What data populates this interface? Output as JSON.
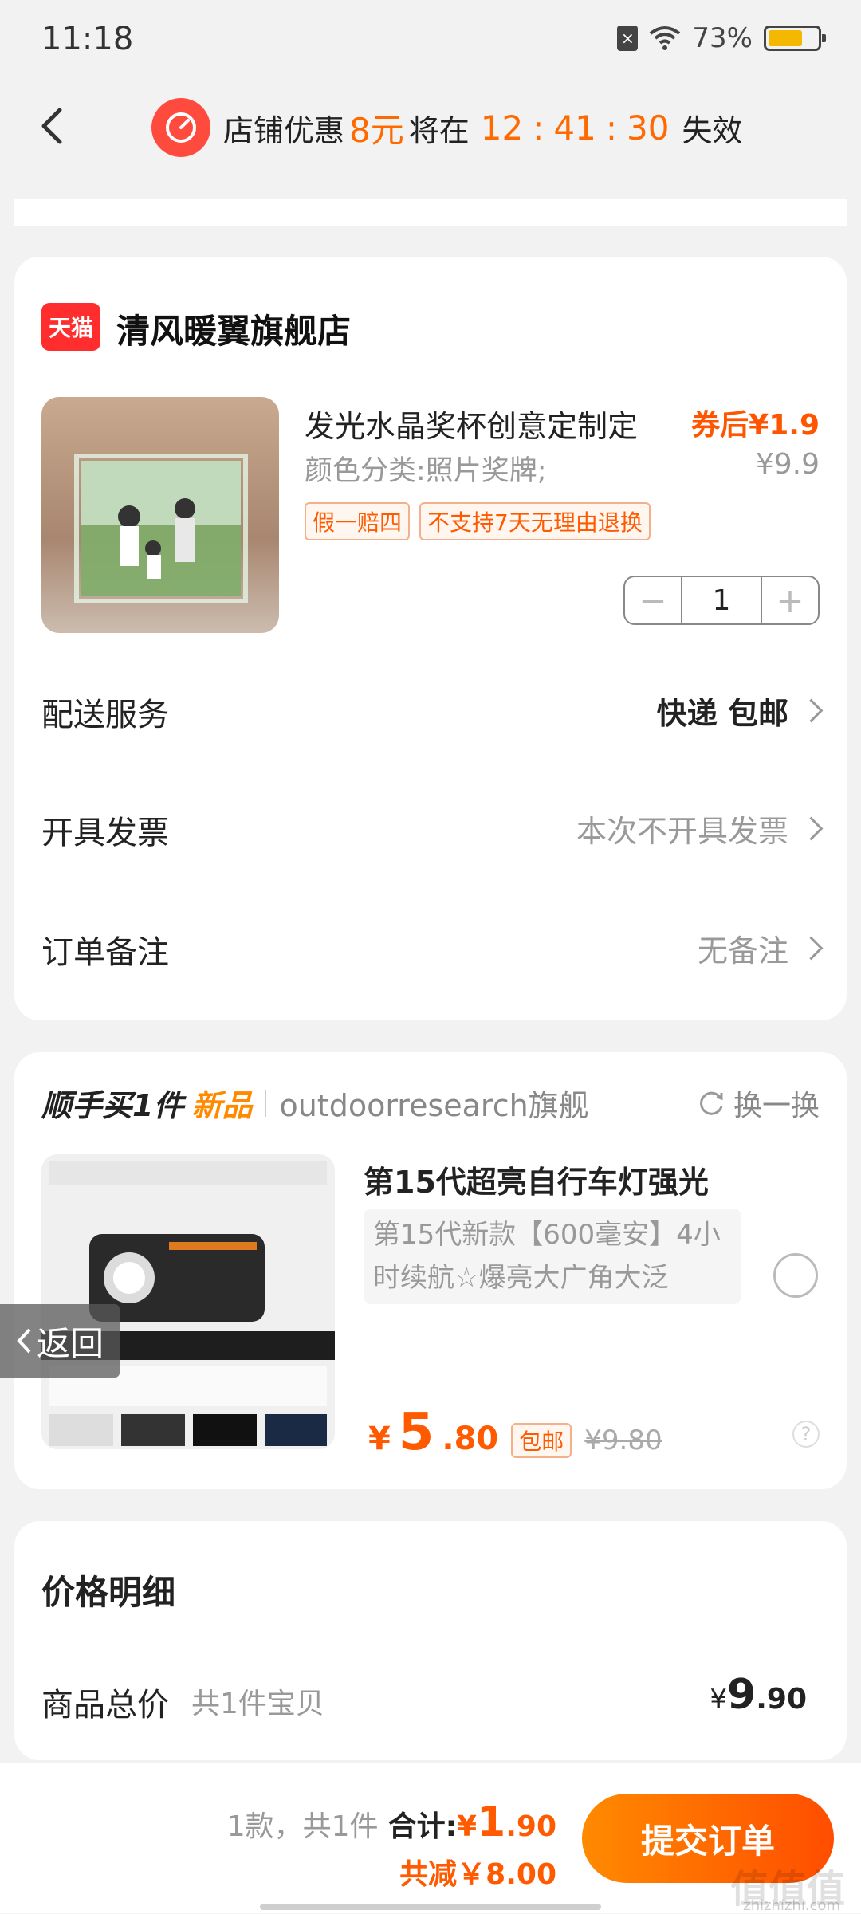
{
  "status_bar": {
    "time": "11:18",
    "battery": "73%",
    "battery_level": 0.73
  },
  "promo": {
    "prefix": "店铺优惠",
    "amount": "8元",
    "middle": "将在",
    "h": "12",
    "m": "41",
    "s": "30",
    "suffix": "失效"
  },
  "store": {
    "badge": "天猫",
    "name": "清风暖翼旗舰店",
    "product": {
      "title": "发光水晶奖杯创意定制定",
      "coupon_price": "券后¥1.9",
      "variant": "颜色分类:照片奖牌;",
      "original_price": "¥9.9",
      "tags": [
        "假一赔四",
        "不支持7天无理由退换"
      ],
      "quantity": "1"
    },
    "rows": [
      {
        "label": "配送服务",
        "value": "快递 包邮"
      },
      {
        "label": "开具发票",
        "value": "本次不开具发票"
      },
      {
        "label": "订单备注",
        "value": "无备注"
      }
    ]
  },
  "recommend": {
    "heading": "顺手买1件",
    "new_label": "新品",
    "shop": "outdoorresearch旗舰",
    "refresh": "换一换",
    "title": "第15代超亮自行车灯强光",
    "desc": "第15代新款【600毫安】4小时续航☆爆亮大广角大泛",
    "price_symbol": "¥",
    "price_int": "5",
    "price_dec": ".80",
    "free_ship": "包邮",
    "old_price": "¥9.80"
  },
  "float_back": "返回",
  "detail": {
    "title": "价格明细",
    "total_label": "商品总价",
    "total_count": "共1件宝贝",
    "total_symbol": "¥",
    "total_int": "9",
    "total_dec": ".90"
  },
  "bottom": {
    "count": "1款，共1件",
    "total_label": "合计:",
    "total_symbol": "¥",
    "total_int": "1",
    "total_dec": ".90",
    "discount": "共减￥8.00",
    "submit": "提交订单"
  },
  "watermark": "值值值",
  "watermark_url": "zhizhizhi.com"
}
